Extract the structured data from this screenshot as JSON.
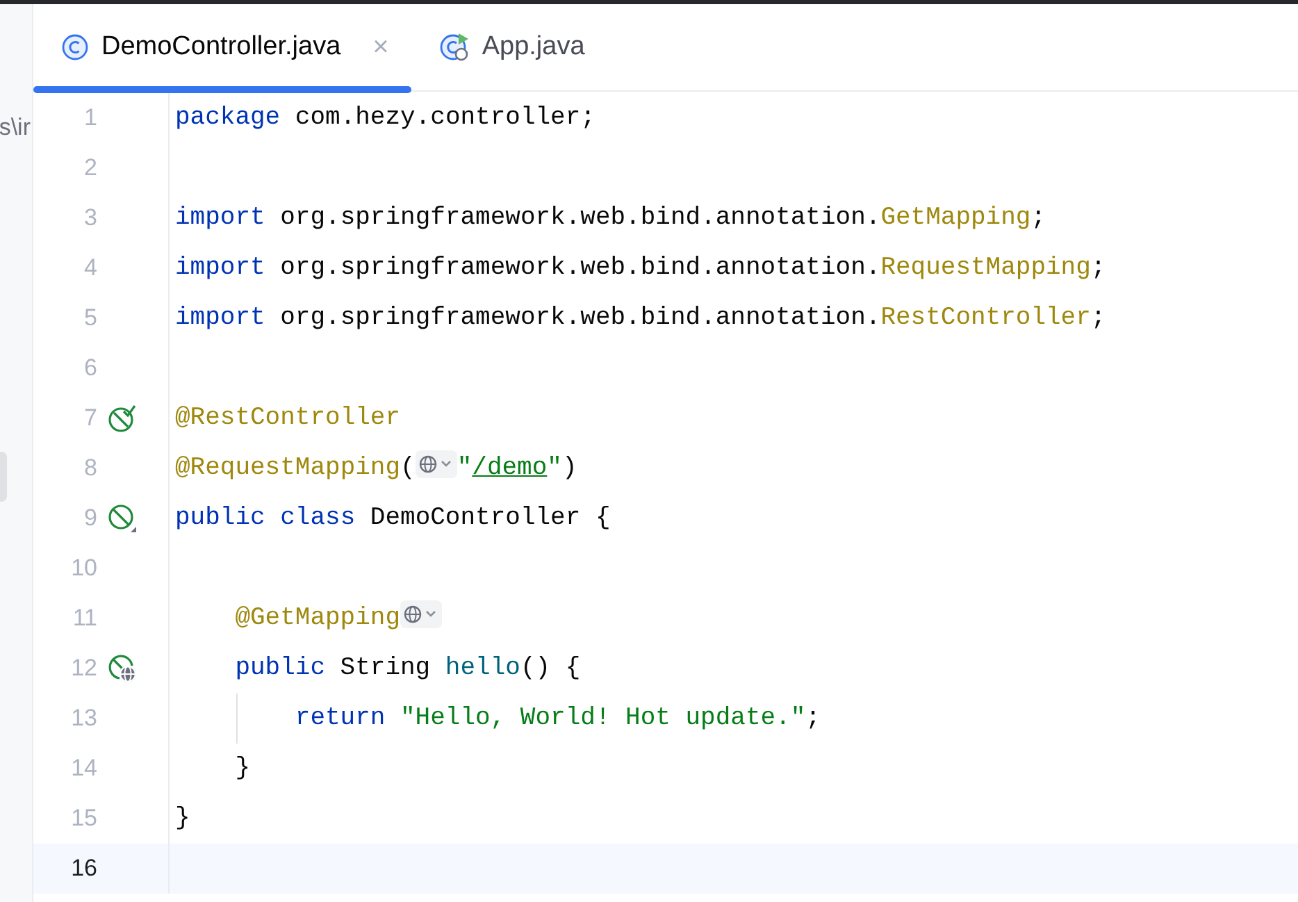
{
  "sidebar_fragment": "s\\ir",
  "tabs": [
    {
      "label": "DemoController.java",
      "kind": "class",
      "selected": true,
      "close": "×"
    },
    {
      "label": "App.java",
      "kind": "app",
      "selected": false
    }
  ],
  "lines": [
    {
      "number": "1",
      "current": false,
      "tokens": [
        {
          "kind": "keyword",
          "text": "package"
        },
        {
          "kind": "plain",
          "text": " com.hezy.controller;"
        }
      ]
    },
    {
      "number": "2",
      "current": false
    },
    {
      "number": "3",
      "current": false,
      "tokens": [
        {
          "kind": "keyword",
          "text": "import"
        },
        {
          "kind": "plain",
          "text": " org.springframework.web.bind.annotation."
        },
        {
          "kind": "annotation",
          "text": "GetMapping"
        },
        {
          "kind": "plain",
          "text": ";"
        }
      ]
    },
    {
      "number": "4",
      "current": false,
      "tokens": [
        {
          "kind": "keyword",
          "text": "import"
        },
        {
          "kind": "plain",
          "text": " org.springframework.web.bind.annotation."
        },
        {
          "kind": "annotation",
          "text": "RequestMapping"
        },
        {
          "kind": "plain",
          "text": ";"
        }
      ]
    },
    {
      "number": "5",
      "current": false,
      "tokens": [
        {
          "kind": "keyword",
          "text": "import"
        },
        {
          "kind": "plain",
          "text": " org.springframework.web.bind.annotation."
        },
        {
          "kind": "annotation",
          "text": "RestController"
        },
        {
          "kind": "plain",
          "text": ";"
        }
      ]
    },
    {
      "number": "6",
      "current": false
    },
    {
      "number": "7",
      "current": false,
      "kind": "check",
      "tokens": [
        {
          "kind": "annotation",
          "text": "@RestController"
        }
      ]
    },
    {
      "number": "8",
      "current": false,
      "tokens": [
        {
          "kind": "annotation",
          "text": "@RequestMapping"
        },
        {
          "kind": "plain",
          "text": "("
        },
        {
          "kind": "hint"
        },
        {
          "kind": "string",
          "text": "\""
        },
        {
          "kind": "link",
          "text": "/demo"
        },
        {
          "kind": "string",
          "text": "\""
        },
        {
          "kind": "plain",
          "text": ")"
        }
      ]
    },
    {
      "number": "9",
      "current": false,
      "kind": "slash",
      "tokens": [
        {
          "kind": "keyword",
          "text": "public class"
        },
        {
          "kind": "plain",
          "text": " DemoController {"
        }
      ],
      "children": [
        {
          "number": "10",
          "current": false
        },
        {
          "number": "11",
          "current": false,
          "tokens": [
            {
              "kind": "annotation",
              "text": "@GetMapping"
            },
            {
              "kind": "hint"
            }
          ]
        },
        {
          "number": "12",
          "current": false,
          "kind": "globe",
          "tokens": [
            {
              "kind": "keyword",
              "text": "public"
            },
            {
              "kind": "plain",
              "text": " String "
            },
            {
              "kind": "method",
              "text": "hello"
            },
            {
              "kind": "plain",
              "text": "() {"
            }
          ],
          "children": [
            {
              "number": "13",
              "current": false,
              "guide": true,
              "tokens": [
                {
                  "kind": "keyword",
                  "text": "return"
                },
                {
                  "kind": "string",
                  "text": " \"Hello, World! Hot update.\""
                },
                {
                  "kind": "plain",
                  "text": ";"
                }
              ]
            }
          ]
        },
        {
          "number": "14",
          "current": false,
          "tokens": [
            {
              "kind": "plain",
              "text": "}"
            }
          ]
        }
      ]
    },
    {
      "number": "15",
      "current": false,
      "tokens": [
        {
          "kind": "plain",
          "text": "}"
        }
      ]
    },
    {
      "number": "16",
      "current": true
    }
  ]
}
